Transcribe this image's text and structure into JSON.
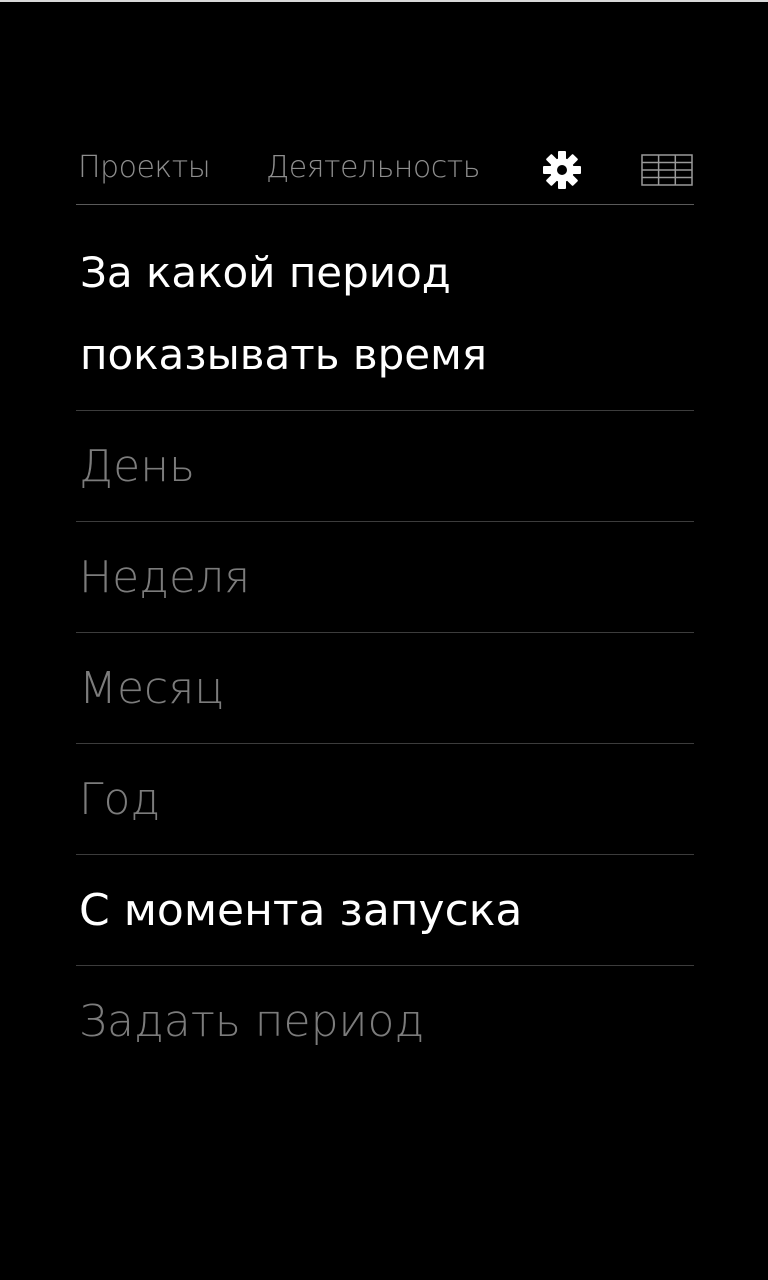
{
  "nav": {
    "tabs": [
      {
        "label": "Проекты"
      },
      {
        "label": "Деятельность"
      }
    ],
    "settings_icon": "gear-icon",
    "grid_icon": "grid-table-icon"
  },
  "heading": {
    "text": "За какой период показывать время"
  },
  "options": [
    {
      "label": "День",
      "selected": false
    },
    {
      "label": "Неделя",
      "selected": false
    },
    {
      "label": "Месяц",
      "selected": false
    },
    {
      "label": "Год",
      "selected": false
    },
    {
      "label": "С момента запуска",
      "selected": true
    },
    {
      "label": "Задать период",
      "selected": false
    }
  ],
  "colors": {
    "background": "#000000",
    "text_selected": "#ffffff",
    "text_muted": "#7c7c7c",
    "nav_text": "#8e8e8e",
    "divider": "#3c3c3c"
  }
}
